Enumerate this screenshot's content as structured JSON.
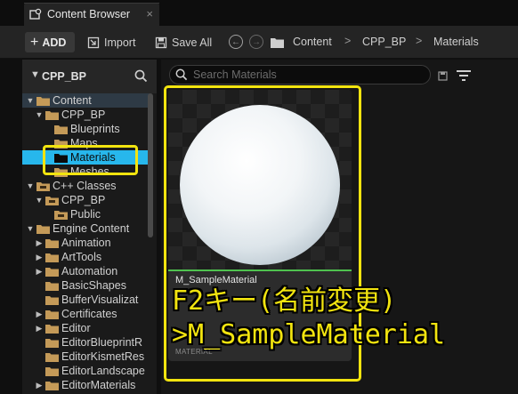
{
  "tab": {
    "title": "Content Browser",
    "close": "×"
  },
  "toolbar": {
    "add_label": "ADD",
    "import_label": "Import",
    "save_all_label": "Save All",
    "breadcrumb": [
      "Content",
      "CPP_BP",
      "Materials"
    ],
    "breadcrumb_sep": ">"
  },
  "sources": {
    "title": "CPP_BP",
    "tree": [
      {
        "label": "Content",
        "arrow": "▼"
      },
      {
        "label": "CPP_BP",
        "arrow": "▼"
      },
      {
        "label": "Blueprints",
        "arrow": ""
      },
      {
        "label": "Maps",
        "arrow": ""
      },
      {
        "label": "Materials",
        "arrow": ""
      },
      {
        "label": "Meshes",
        "arrow": ""
      },
      {
        "label": "C++ Classes",
        "arrow": "▼"
      },
      {
        "label": "CPP_BP",
        "arrow": "▼"
      },
      {
        "label": "Public",
        "arrow": ""
      },
      {
        "label": "Engine Content",
        "arrow": "▼"
      },
      {
        "label": "Animation",
        "arrow": "▶"
      },
      {
        "label": "ArtTools",
        "arrow": "▶"
      },
      {
        "label": "Automation",
        "arrow": "▶"
      },
      {
        "label": "BasicShapes",
        "arrow": ""
      },
      {
        "label": "BufferVisualizat",
        "arrow": ""
      },
      {
        "label": "Certificates",
        "arrow": "▶"
      },
      {
        "label": "Editor",
        "arrow": "▶"
      },
      {
        "label": "EditorBlueprintR",
        "arrow": ""
      },
      {
        "label": "EditorKismetRes",
        "arrow": ""
      },
      {
        "label": "EditorLandscape",
        "arrow": ""
      },
      {
        "label": "EditorMaterials",
        "arrow": "▶"
      }
    ]
  },
  "assets": {
    "search_placeholder": "Search Materials",
    "items": [
      {
        "name": "M_SampleMaterial",
        "type": "MATERIAL"
      }
    ]
  },
  "annotation": {
    "line1": "F2キー(名前変更)",
    "line2": ">M_SampleMaterial"
  },
  "colors": {
    "selection": "#27b7ec",
    "annotation": "#f2e40f",
    "folder": "#c49a58",
    "asset_bar": "#4fc24f"
  }
}
